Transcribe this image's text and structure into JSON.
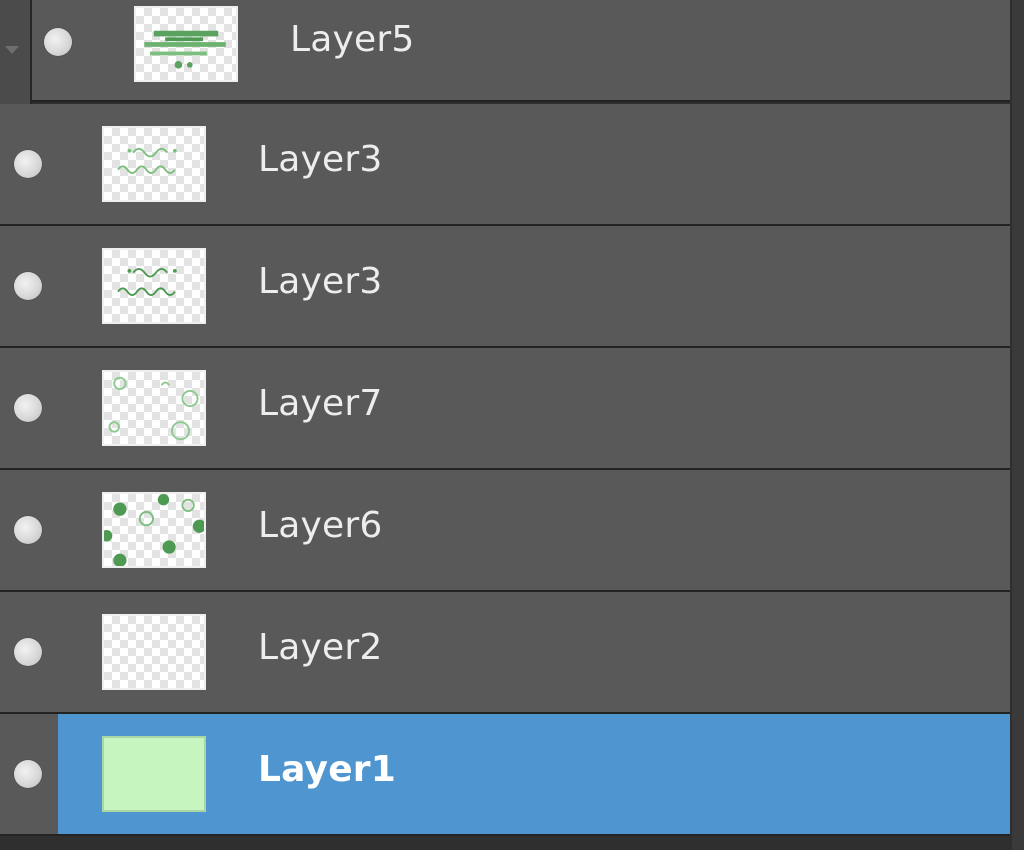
{
  "layers_panel": {
    "group": {
      "collapse_icon": "chevron-down-icon"
    },
    "layers": [
      {
        "name": "Layer5",
        "thumbnail": "green-stripes",
        "visible": true,
        "selected": false,
        "in_group": true
      },
      {
        "name": "Layer3",
        "thumbnail": "green-handwriting",
        "visible": true,
        "selected": false,
        "in_group": false
      },
      {
        "name": "Layer3",
        "thumbnail": "green-handwriting",
        "visible": true,
        "selected": false,
        "in_group": false
      },
      {
        "name": "Layer7",
        "thumbnail": "green-swirls",
        "visible": true,
        "selected": false,
        "in_group": false
      },
      {
        "name": "Layer6",
        "thumbnail": "green-dots",
        "visible": true,
        "selected": false,
        "in_group": false
      },
      {
        "name": "Layer2",
        "thumbnail": "empty-transparent",
        "visible": true,
        "selected": false,
        "in_group": false
      },
      {
        "name": "Layer1",
        "thumbnail": "solid-light-green",
        "visible": true,
        "selected": true,
        "in_group": false
      }
    ],
    "colors": {
      "row_background": "#595959",
      "selection": "#4f95cf",
      "thumbnail_green": "#5aa35f",
      "layer1_fill": "#c6f5c0"
    },
    "visibility_icon": "eye-dot-icon"
  }
}
